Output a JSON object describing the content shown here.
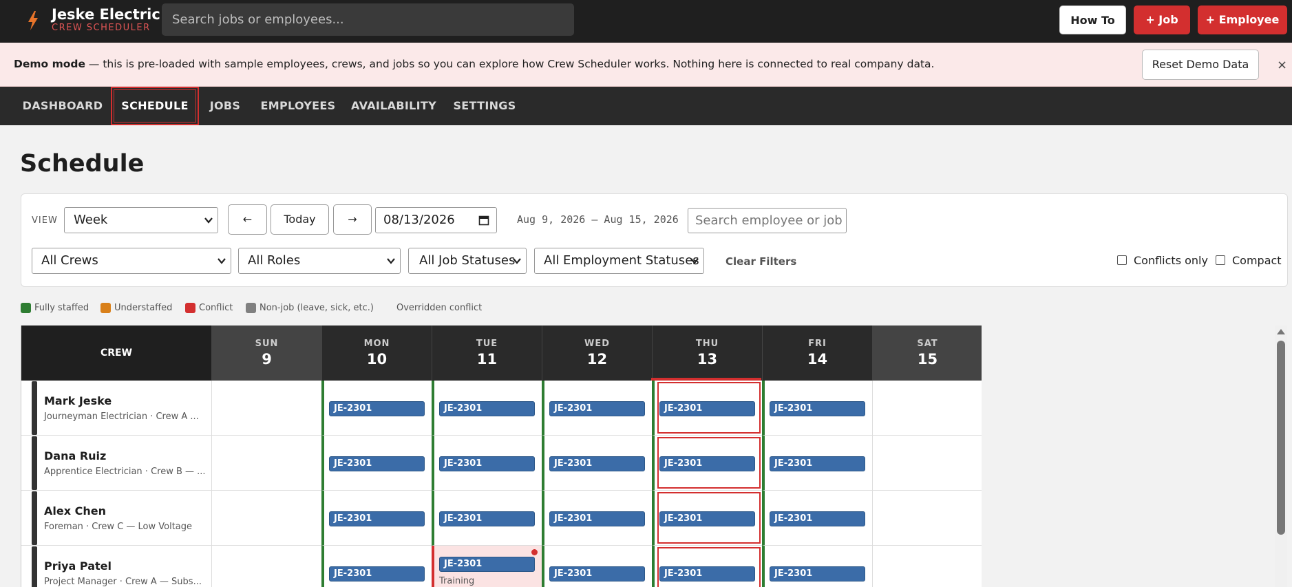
{
  "brand": {
    "name": "Jeske Electric",
    "subtitle": "CREW SCHEDULER"
  },
  "search": {
    "placeholder": "Search jobs or employees..."
  },
  "header_buttons": {
    "how_to": "How To",
    "add_job": "+ Job",
    "add_employee": "+ Employee"
  },
  "banner": {
    "bold": "Demo mode",
    "text": " — this is pre-loaded with sample employees, crews, and jobs so you can explore how Crew Scheduler works. Nothing here is connected to real company data.",
    "reset_label": "Reset Demo Data",
    "close": "×"
  },
  "nav": {
    "tabs": [
      {
        "label": "DASHBOARD",
        "active": false
      },
      {
        "label": "SCHEDULE",
        "active": true
      },
      {
        "label": "JOBS",
        "active": false
      },
      {
        "label": "EMPLOYEES",
        "active": false
      },
      {
        "label": "AVAILABILITY",
        "active": false
      },
      {
        "label": "SETTINGS",
        "active": false
      }
    ]
  },
  "page": {
    "title": "Schedule"
  },
  "filters": {
    "view_label": "VIEW",
    "view_value": "Week",
    "prev": "←",
    "today": "Today",
    "next": "→",
    "date_value": "08/13/2026",
    "date_range": "Aug 9, 2026 – Aug 15, 2026",
    "search_placeholder": "Search employee or job",
    "crews": "All Crews",
    "roles": "All Roles",
    "job_statuses": "All Job Statuses",
    "employment_statuses": "All Employment Statuses",
    "clear": "Clear Filters",
    "conflicts_only": "Conflicts only",
    "compact": "Compact"
  },
  "legend": {
    "fully_staffed": {
      "label": "Fully staffed",
      "color": "#2e7d32"
    },
    "understaffed": {
      "label": "Understaffed",
      "color": "#d9801a"
    },
    "conflict": {
      "label": "Conflict",
      "color": "#d32f2f"
    },
    "non_job": {
      "label": "Non-job (leave, sick, etc.)",
      "color": "#808080"
    },
    "overridden": {
      "label": "Overridden conflict"
    }
  },
  "schedule": {
    "crew_header": "CREW",
    "days": [
      {
        "dow": "SUN",
        "num": "9"
      },
      {
        "dow": "MON",
        "num": "10"
      },
      {
        "dow": "TUE",
        "num": "11"
      },
      {
        "dow": "WED",
        "num": "12"
      },
      {
        "dow": "THU",
        "num": "13"
      },
      {
        "dow": "FRI",
        "num": "14"
      },
      {
        "dow": "SAT",
        "num": "15"
      }
    ],
    "rows": [
      {
        "name": "Mark Jeske",
        "sub": "Journeyman Electrician · Crew A ...",
        "job": "JE-2301"
      },
      {
        "name": "Dana Ruiz",
        "sub": "Apprentice Electrician · Crew B — ...",
        "job": "JE-2301"
      },
      {
        "name": "Alex Chen",
        "sub": "Foreman · Crew C — Low Voltage",
        "job": "JE-2301"
      },
      {
        "name": "Priya Patel",
        "sub": "Project Manager · Crew A — Subs...",
        "job": "JE-2301",
        "tue_note": "Training"
      }
    ]
  }
}
